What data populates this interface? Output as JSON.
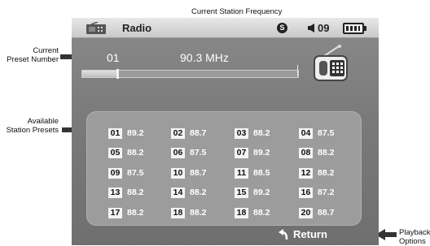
{
  "annotations": {
    "top": "Current Station Frequency",
    "left_preset_line1": "Current",
    "left_preset_line2": "Preset Number",
    "left_available_line1": "Available",
    "left_available_line2": "Station Presets",
    "right_playback_line1": "Playback",
    "right_playback_line2": "Options"
  },
  "statusbar": {
    "title": "Radio",
    "s_badge": "S",
    "volume": "09",
    "icons": [
      "radio-icon",
      "s-badge-icon",
      "speaker-icon",
      "battery-icon"
    ]
  },
  "current": {
    "preset_number": "01",
    "frequency": "90.3 MHz",
    "progress": 0.16
  },
  "presets": [
    {
      "num": "01",
      "freq": "89.2"
    },
    {
      "num": "02",
      "freq": "88.7"
    },
    {
      "num": "03",
      "freq": "88.2"
    },
    {
      "num": "04",
      "freq": "87.5"
    },
    {
      "num": "05",
      "freq": "88.2"
    },
    {
      "num": "06",
      "freq": "87.5"
    },
    {
      "num": "07",
      "freq": "89.2"
    },
    {
      "num": "08",
      "freq": "88.2"
    },
    {
      "num": "09",
      "freq": "87.5"
    },
    {
      "num": "10",
      "freq": "88.7"
    },
    {
      "num": "11",
      "freq": "88.5"
    },
    {
      "num": "12",
      "freq": "88.2"
    },
    {
      "num": "13",
      "freq": "88.2"
    },
    {
      "num": "14",
      "freq": "88.2"
    },
    {
      "num": "15",
      "freq": "89.2"
    },
    {
      "num": "16",
      "freq": "87.2"
    },
    {
      "num": "17",
      "freq": "88.2"
    },
    {
      "num": "18",
      "freq": "88.2"
    },
    {
      "num": "18",
      "freq": "88.2"
    },
    {
      "num": "20",
      "freq": "88.7"
    }
  ],
  "return_button": {
    "label": "Return",
    "icon": "return-arrow-icon"
  }
}
